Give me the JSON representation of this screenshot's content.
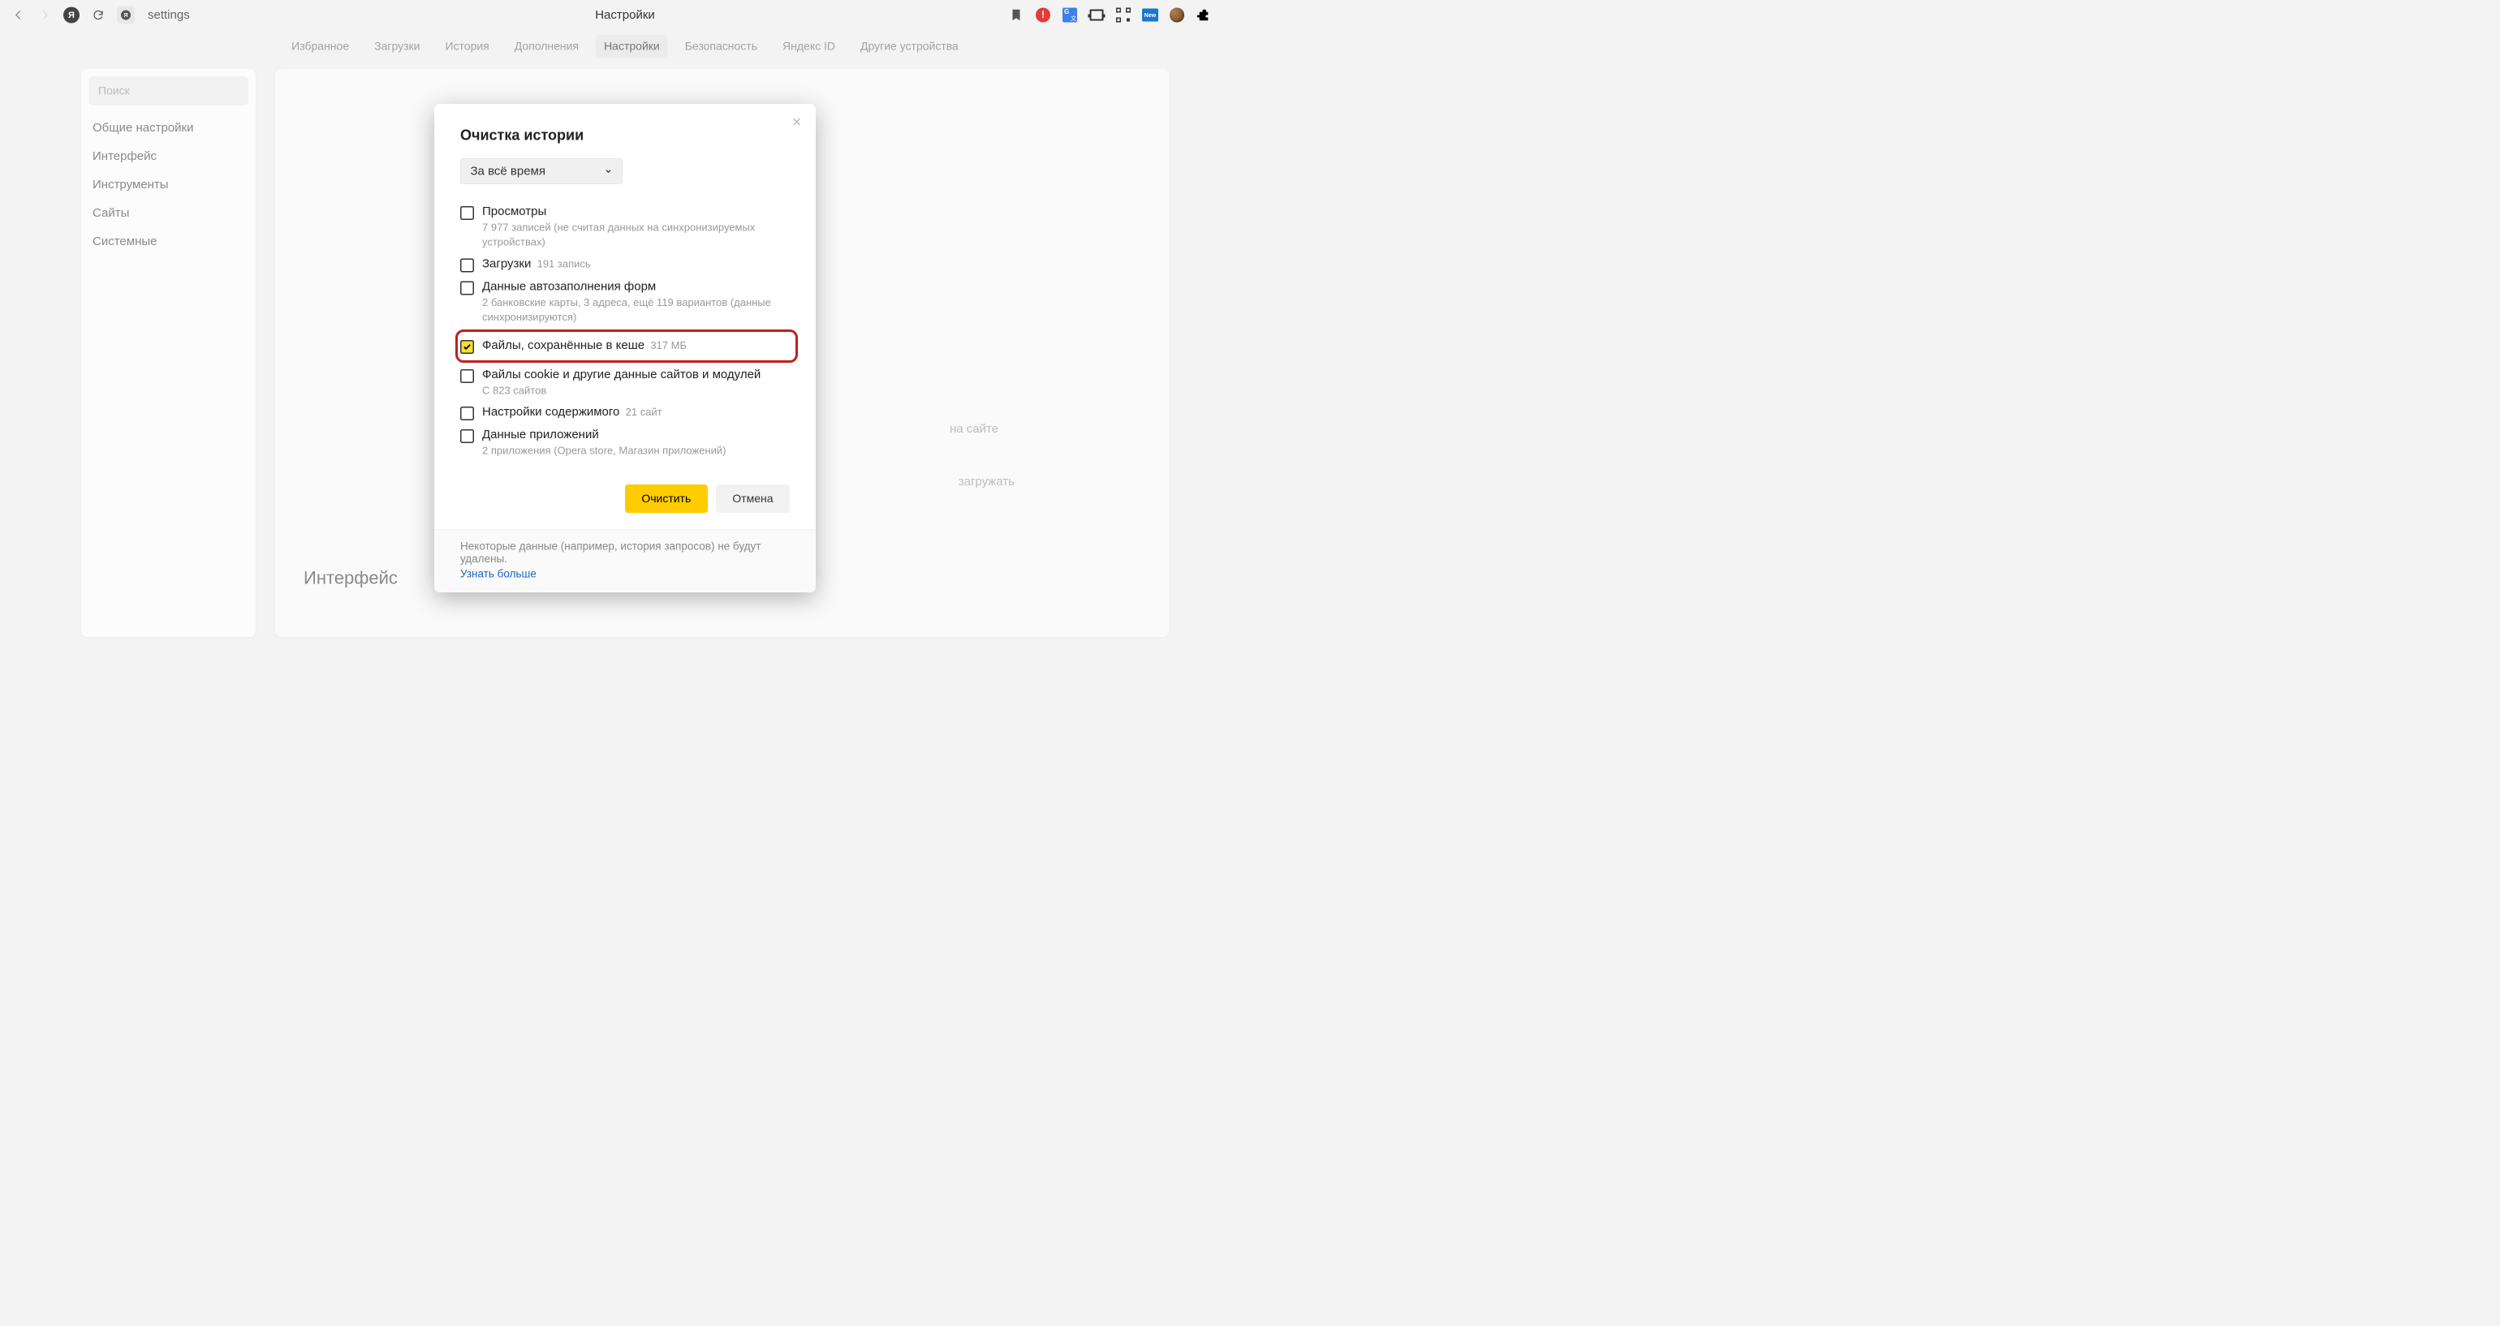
{
  "chrome": {
    "address": "settings",
    "page_title": "Настройки",
    "new_badge": "New"
  },
  "tabs": {
    "items": [
      {
        "label": "Избранное"
      },
      {
        "label": "Загрузки"
      },
      {
        "label": "История"
      },
      {
        "label": "Дополнения"
      },
      {
        "label": "Настройки",
        "active": true
      },
      {
        "label": "Безопасность"
      },
      {
        "label": "Яндекс ID"
      },
      {
        "label": "Другие устройства"
      }
    ]
  },
  "sidebar": {
    "search_placeholder": "Поиск",
    "items": [
      {
        "label": "Общие настройки"
      },
      {
        "label": "Интерфейс"
      },
      {
        "label": "Инструменты"
      },
      {
        "label": "Сайты"
      },
      {
        "label": "Системные"
      }
    ]
  },
  "content": {
    "obscured1": "на сайте",
    "obscured2": "загружать",
    "heading": "Интерфейс"
  },
  "modal": {
    "title": "Очистка истории",
    "range": "За всё время",
    "items": {
      "views": {
        "label": "Просмотры",
        "sub": "7 977 записей (не считая данных на синхронизируемых устройствах)",
        "checked": false
      },
      "downloads": {
        "label": "Загрузки",
        "meta": "191 запись",
        "checked": false
      },
      "autofill": {
        "label": "Данные автозаполнения форм",
        "sub": "2 банковские карты, 3 адреса, ещё 119 вариантов (данные синхронизируются)",
        "checked": false
      },
      "cache": {
        "label": "Файлы, сохранённые в кеше",
        "meta": "317 МБ",
        "checked": true,
        "highlight": true
      },
      "cookies": {
        "label": "Файлы cookie и другие данные сайтов и модулей",
        "sub": "С 823 сайтов",
        "checked": false
      },
      "content": {
        "label": "Настройки содержимого",
        "meta": "21 сайт",
        "checked": false
      },
      "apps": {
        "label": "Данные приложений",
        "sub": "2 приложения (Opera store, Магазин приложений)",
        "checked": false
      }
    },
    "clear_button": "Очистить",
    "cancel_button": "Отмена",
    "footer_text": "Некоторые данные (например, история запросов) не будут удалены.",
    "footer_link": "Узнать больше"
  }
}
